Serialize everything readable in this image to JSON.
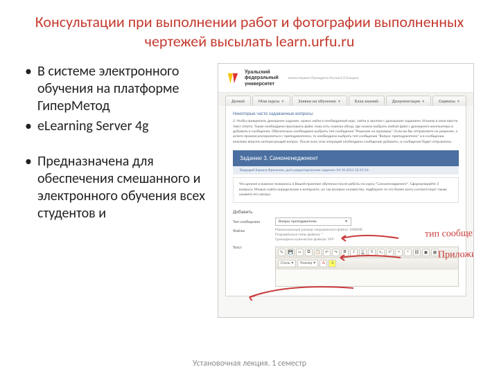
{
  "title": "Консультации при выполнении работ и фотографии выполненных чертежей высылать learn.urfu.ru",
  "bullets": {
    "b1": "В системе электронного обучения на платформе ГиперМетод",
    "b2": "eLearning Server 4g",
    "b3": "Предназначена для обеспечения смешанного и электронного обучения всех студентов и"
  },
  "screenshot": {
    "logo": {
      "line1": "Уральский",
      "line2": "федеральный",
      "line3": "университет",
      "sub": "имени первого Президента России Б.Н.Ельцина"
    },
    "tabs": {
      "home": "Домой",
      "courses": "Мои курсы",
      "requests": "Заявки на обучение",
      "kb": "База знаний",
      "docs": "Документация",
      "services": "Сервисы"
    },
    "faq": {
      "heading": "Некоторые часто задаваемые вопросы",
      "text": "2. Чтобы прикрепить домашнее задание, нужно зайти в необходимый курс, зайти в занятие с домашним заданием. И внизу в окне ввести текст ответа. Также необходимо приложить файл, пока есть главная обзор, где можно выбрать любой файл с домашнего компьютера и добавить в сообщение. Обязательно необходимо выбрать тип сообщения \"Решение на проверку\". Если же Вы отправляете не решение, а хотите проконсультироваться с преподавателем, то необходимо выбрать тип сообщения \"Вопрос преподавателю\" и в сообщении вежливо вписать интересующий вопрос. После всех этих операций необходимо сообщение добавить, и сообщение будет отправлено."
    },
    "task": {
      "title": "Задание 3. Самоменеджмент",
      "sub": "Ведущий Карина Франкова, дата редактирования задания: 04.10.2012 22:19:36",
      "card": "Что ценное и важное появилось в Вашей практике обучения после работы по курсу \"Самоменеджмент\". Сформулируйте 3 вопроса. Можно найти определение в интернете, но так великое множество, подберите то что более всего соответствует также укажите его автора."
    },
    "form": {
      "addTitle": "Добавить",
      "typeLabel": "Тип сообщения",
      "typeValue": "Вопрос преподавателю",
      "filesLabel": "Файлы",
      "hint1": "Максимальный размер загружаемого файла: 1000Мб",
      "hint2": "Разрешённые типы файлов: *",
      "hint3": "Суммарное количество файлов: 999",
      "textLabel": "Текст",
      "styleSel": "Стиль",
      "paraSel": "Размер"
    },
    "annotations": {
      "a1": "тип сообщения",
      "a2": "Приложить фа"
    }
  },
  "footer": "Установочная лекция. 1 семестр"
}
